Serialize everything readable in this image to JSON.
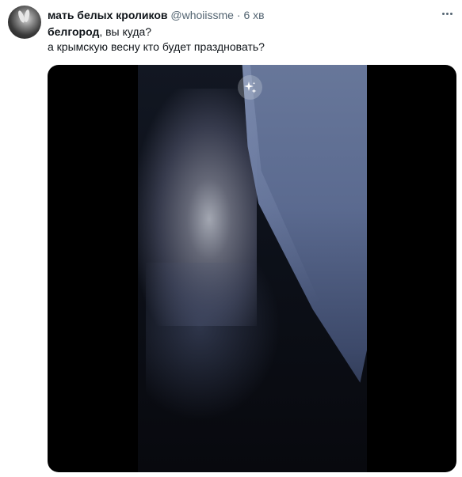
{
  "tweet": {
    "display_name": "мать белых кроликов",
    "handle": "@whoiissme",
    "separator": "·",
    "time": "6 хв",
    "text_bold": "белгород",
    "text_line1_rest": ", вы куда?",
    "text_line2": "а крымскую весну кто будет праздновать?"
  },
  "icons": {
    "more": "more-horizontal-icon",
    "media_effect": "sparkles-icon"
  },
  "colors": {
    "text": "#0f1419",
    "secondary": "#536471"
  }
}
